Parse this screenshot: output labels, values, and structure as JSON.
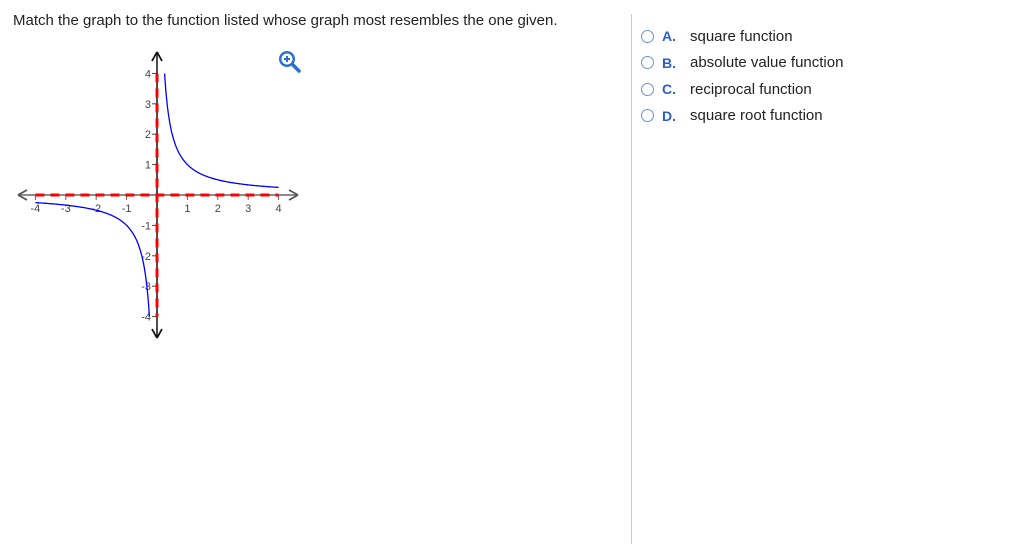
{
  "question": "Match the graph to the function listed whose graph most resembles the one given.",
  "options": [
    {
      "letter": "A.",
      "label": "square function"
    },
    {
      "letter": "B.",
      "label": "absolute value function"
    },
    {
      "letter": "C.",
      "label": "reciprocal function"
    },
    {
      "letter": "D.",
      "label": "square root function"
    }
  ],
  "colors": {
    "curve": "#0000ff",
    "asymptote": "#ff0000",
    "accent": "#2b6fd0"
  },
  "chart_data": {
    "type": "line",
    "xlim": [
      -4,
      4
    ],
    "ylim": [
      -4,
      4
    ],
    "xticks": [
      "-4",
      "-3",
      "-2",
      "-1",
      "1",
      "2",
      "3",
      "4"
    ],
    "yticks": [
      "4",
      "3",
      "2",
      "1",
      "-1",
      "-2",
      "-3",
      "-4"
    ],
    "series": [
      {
        "name": "y = 1/x",
        "domain": [
          [
            -4,
            -0.25
          ],
          [
            0.25,
            4
          ]
        ]
      }
    ],
    "asymptotes": [
      {
        "type": "vertical",
        "x": 0
      },
      {
        "type": "horizontal",
        "y": 0
      }
    ]
  }
}
